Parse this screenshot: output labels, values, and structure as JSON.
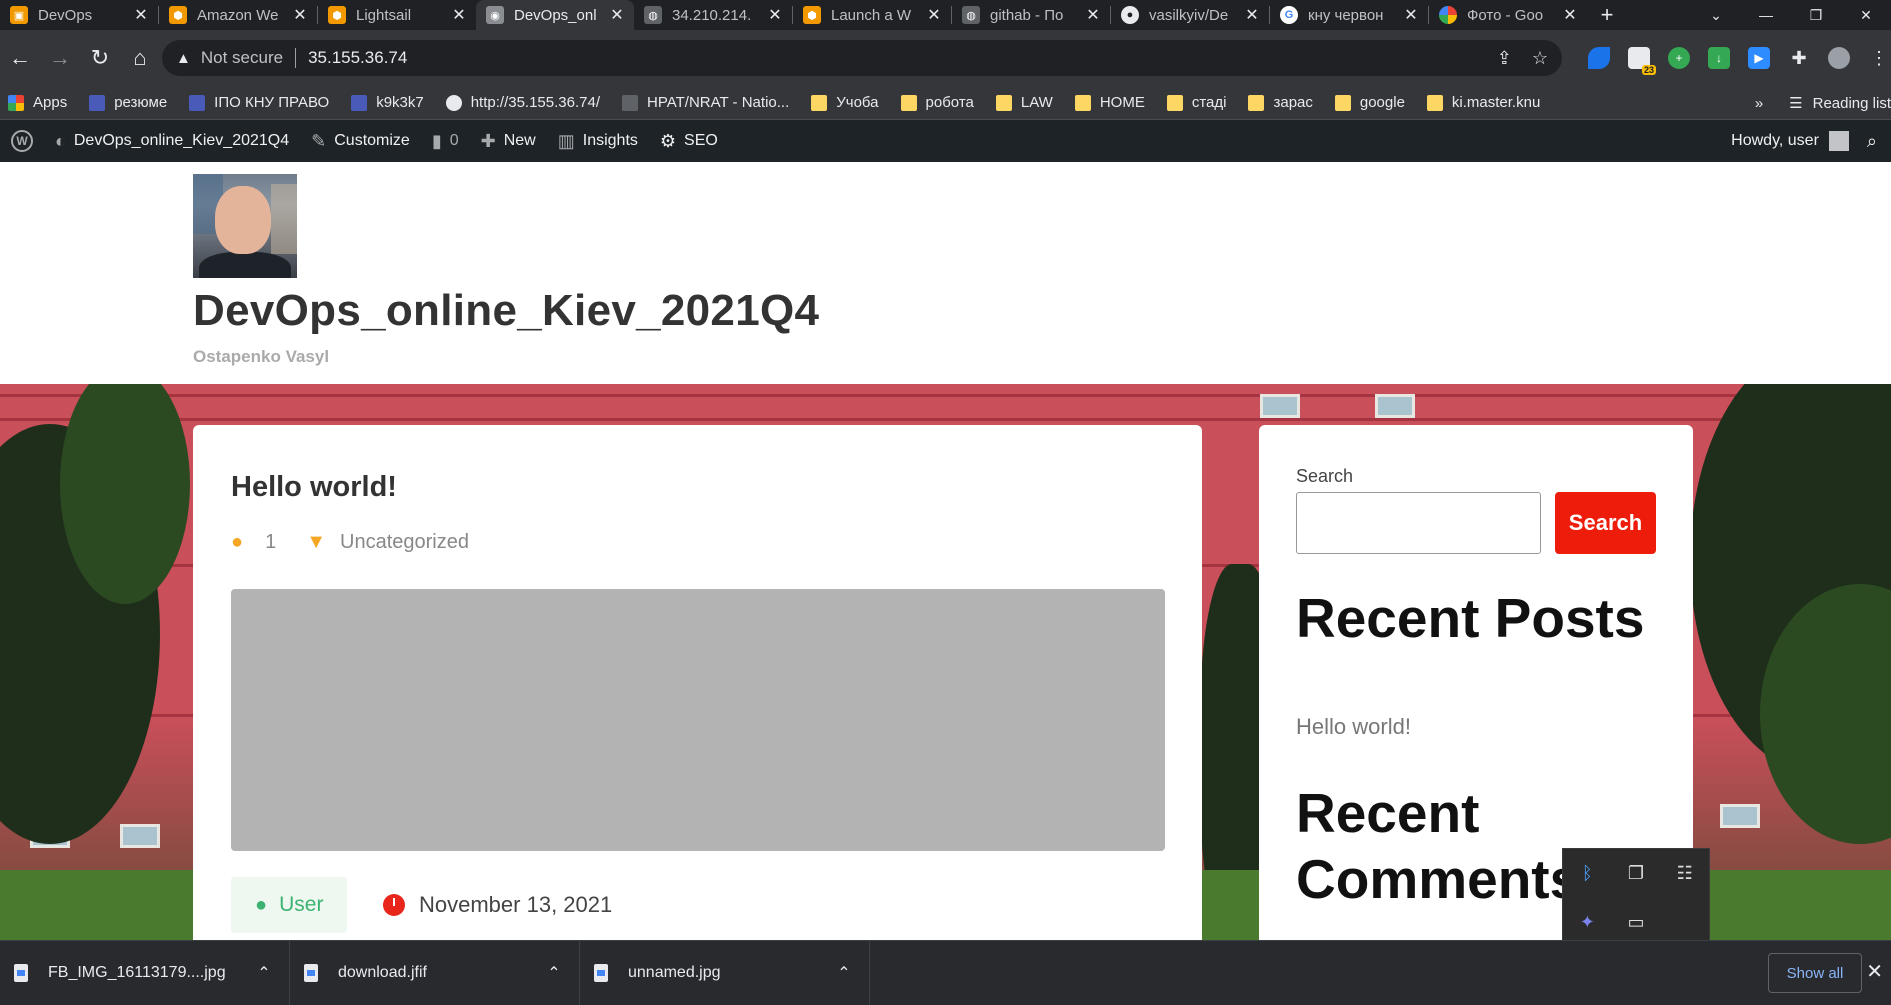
{
  "browser": {
    "tabs": [
      {
        "title": "DevOps",
        "favicon_color": "#f29900",
        "active": false
      },
      {
        "title": "Amazon We",
        "favicon_color": "#f29900",
        "active": false
      },
      {
        "title": "Lightsail",
        "favicon_color": "#f29900",
        "active": false
      },
      {
        "title": "DevOps_onl",
        "favicon_color": "#8a8d91",
        "active": true
      },
      {
        "title": "34.210.214.",
        "favicon_color": "#5f6368",
        "active": false
      },
      {
        "title": "Launch a W",
        "favicon_color": "#f29900",
        "active": false
      },
      {
        "title": "githab - По",
        "favicon_color": "#5f6368",
        "active": false
      },
      {
        "title": "vasilkyiv/De",
        "favicon_color": "#e8eaed",
        "active": false
      },
      {
        "title": "кну червон",
        "favicon_color": "#4285f4",
        "active": false
      },
      {
        "title": "Фото - Goo",
        "favicon_color": "#34a853",
        "active": false
      }
    ],
    "new_tab_glyph": "+",
    "address": {
      "security_label": "Not secure",
      "url": "35.155.36.74"
    },
    "extension_badge": "23",
    "bookmarks": [
      {
        "label": "Apps",
        "icon": "apps"
      },
      {
        "label": "резюме",
        "icon": "blue"
      },
      {
        "label": "ІПО КНУ ПРАВО",
        "icon": "blue"
      },
      {
        "label": "k9k3k7",
        "icon": "blue"
      },
      {
        "label": "http://35.155.36.74/",
        "icon": "wp"
      },
      {
        "label": "HPAT/NRAT - Natio...",
        "icon": "grey"
      },
      {
        "label": "Учоба",
        "icon": "folder"
      },
      {
        "label": "робота",
        "icon": "folder"
      },
      {
        "label": "LAW",
        "icon": "folder"
      },
      {
        "label": "HOME",
        "icon": "folder"
      },
      {
        "label": "стаді",
        "icon": "folder"
      },
      {
        "label": "зарас",
        "icon": "folder"
      },
      {
        "label": "google",
        "icon": "folder"
      },
      {
        "label": "ki.master.knu",
        "icon": "folder"
      }
    ],
    "bookmarks_overflow": "»",
    "reading_list": "Reading list"
  },
  "wp_admin_bar": {
    "site_name": "DevOps_online_Kiev_2021Q4",
    "customize": "Customize",
    "comments_count": "0",
    "new": "New",
    "insights": "Insights",
    "seo": "SEO",
    "howdy": "Howdy, user"
  },
  "site": {
    "title": "DevOps_online_Kiev_2021Q4",
    "tagline": "Ostapenko Vasyl"
  },
  "post": {
    "title": "Hello world!",
    "comments": "1",
    "category": "Uncategorized",
    "author": "User",
    "date": "November 13, 2021"
  },
  "sidebar": {
    "search_label": "Search",
    "search_button": "Search",
    "search_value": "",
    "recent_posts_title": "Recent Posts",
    "recent_posts": [
      "Hello world!"
    ],
    "recent_comments_title_1": "Recent",
    "recent_comments_title_2": "Comments"
  },
  "downloads": [
    {
      "name": "FB_IMG_16113179....jpg"
    },
    {
      "name": "download.jfif"
    },
    {
      "name": "unnamed.jpg"
    }
  ],
  "downloads_show_all": "Show all",
  "colors": {
    "search_button": "#ee1c0a",
    "accent_orange": "#f5a623",
    "author_green": "#3cb371",
    "wp_bar": "#1d2327"
  }
}
